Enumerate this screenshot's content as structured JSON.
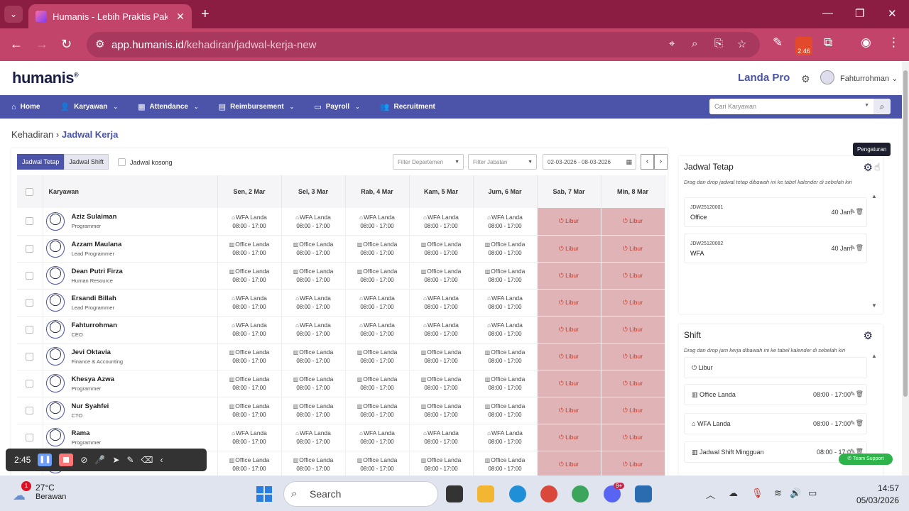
{
  "browser": {
    "tab_title": "Humanis - Lebih Praktis Pakai H",
    "url_host": "app.humanis.id",
    "url_path": "/kehadiran/jadwal-kerja-new",
    "rec_time": "2:46"
  },
  "header": {
    "logo": "humanis",
    "plan": "Landa Pro",
    "user": "Fahturrohman"
  },
  "menu": {
    "items": [
      "Home",
      "Karyawan",
      "Attendance",
      "Reimbursement",
      "Payroll",
      "Recruitment"
    ],
    "search_placeholder": "Cari Karyawan"
  },
  "breadcrumb": {
    "parent": "Kehadiran",
    "current": "Jadwal Kerja"
  },
  "toolbar": {
    "tab_fixed": "Jadwal Tetap",
    "tab_shift": "Jadwal Shift",
    "empty_label": "Jadwal kosong",
    "filter_department": "Filter Departemen",
    "filter_position": "Filter Jabatan",
    "date_range": "02-03-2026 - 08-03-2026"
  },
  "table": {
    "employee_header": "Karyawan",
    "days": [
      "Sen, 2 Mar",
      "Sel, 3 Mar",
      "Rab, 4 Mar",
      "Kam, 5 Mar",
      "Jum, 6 Mar",
      "Sab, 7 Mar",
      "Min, 8 Mar"
    ],
    "off_label": "Libur",
    "shift_time": "08:00 - 17:00",
    "rows": [
      {
        "name": "Aziz Sulaiman",
        "role": "Programmer",
        "shift": "WFA Landa",
        "kind": "wfa"
      },
      {
        "name": "Azzam Maulana",
        "role": "Lead Programmer",
        "shift": "Office Landa",
        "kind": "office"
      },
      {
        "name": "Dean Putri Firza",
        "role": "Human Resource",
        "shift": "Office Landa",
        "kind": "office"
      },
      {
        "name": "Ersandi Billah",
        "role": "Lead Programmer",
        "shift": "WFA Landa",
        "kind": "wfa"
      },
      {
        "name": "Fahturrohman",
        "role": "CEO",
        "shift": "WFA Landa",
        "kind": "wfa"
      },
      {
        "name": "Jevi Oktavia",
        "role": "Finance & Accounting",
        "shift": "Office Landa",
        "kind": "office"
      },
      {
        "name": "Khesya Azwa",
        "role": "Programmer",
        "shift": "Office Landa",
        "kind": "office"
      },
      {
        "name": "Nur Syahfei",
        "role": "CTO",
        "shift": "Office Landa",
        "kind": "office"
      },
      {
        "name": "Rama",
        "role": "Programmer",
        "shift": "WFA Landa",
        "kind": "wfa"
      },
      {
        "name": "",
        "role": "",
        "shift": "Office Landa",
        "kind": "office"
      }
    ]
  },
  "fixed_panel": {
    "title": "Jadwal Tetap",
    "hint": "Drag dan drop jadwal tetap dibawah ini ke tabel kalender di sebelah kiri",
    "tooltip": "Pengaturan",
    "items": [
      {
        "code": "JDW25120001",
        "name": "Office",
        "hours": "40 Jam"
      },
      {
        "code": "JDW25120002",
        "name": "WFA",
        "hours": "40 Jam"
      }
    ]
  },
  "shift_panel": {
    "title": "Shift",
    "hint": "Drag dan drop jam kerja dibawah ini ke tabel kalender di sebelah kiri",
    "items": [
      {
        "name": "Libur",
        "time": ""
      },
      {
        "name": "Office Landa",
        "time": "08:00 - 17:00"
      },
      {
        "name": "WFA Landa",
        "time": "08:00 - 17:00"
      },
      {
        "name": "Jadwal Shift Mingguan",
        "time": "08:00 - 17:0"
      }
    ],
    "support": "Team Support"
  },
  "recorder": {
    "time": "2:45"
  },
  "taskbar": {
    "temp": "27°C",
    "weather": "Berawan",
    "weather_badge": "1",
    "search": "Search",
    "time": "14:57",
    "date": "05/03/2026",
    "discord_badge": "9+"
  }
}
